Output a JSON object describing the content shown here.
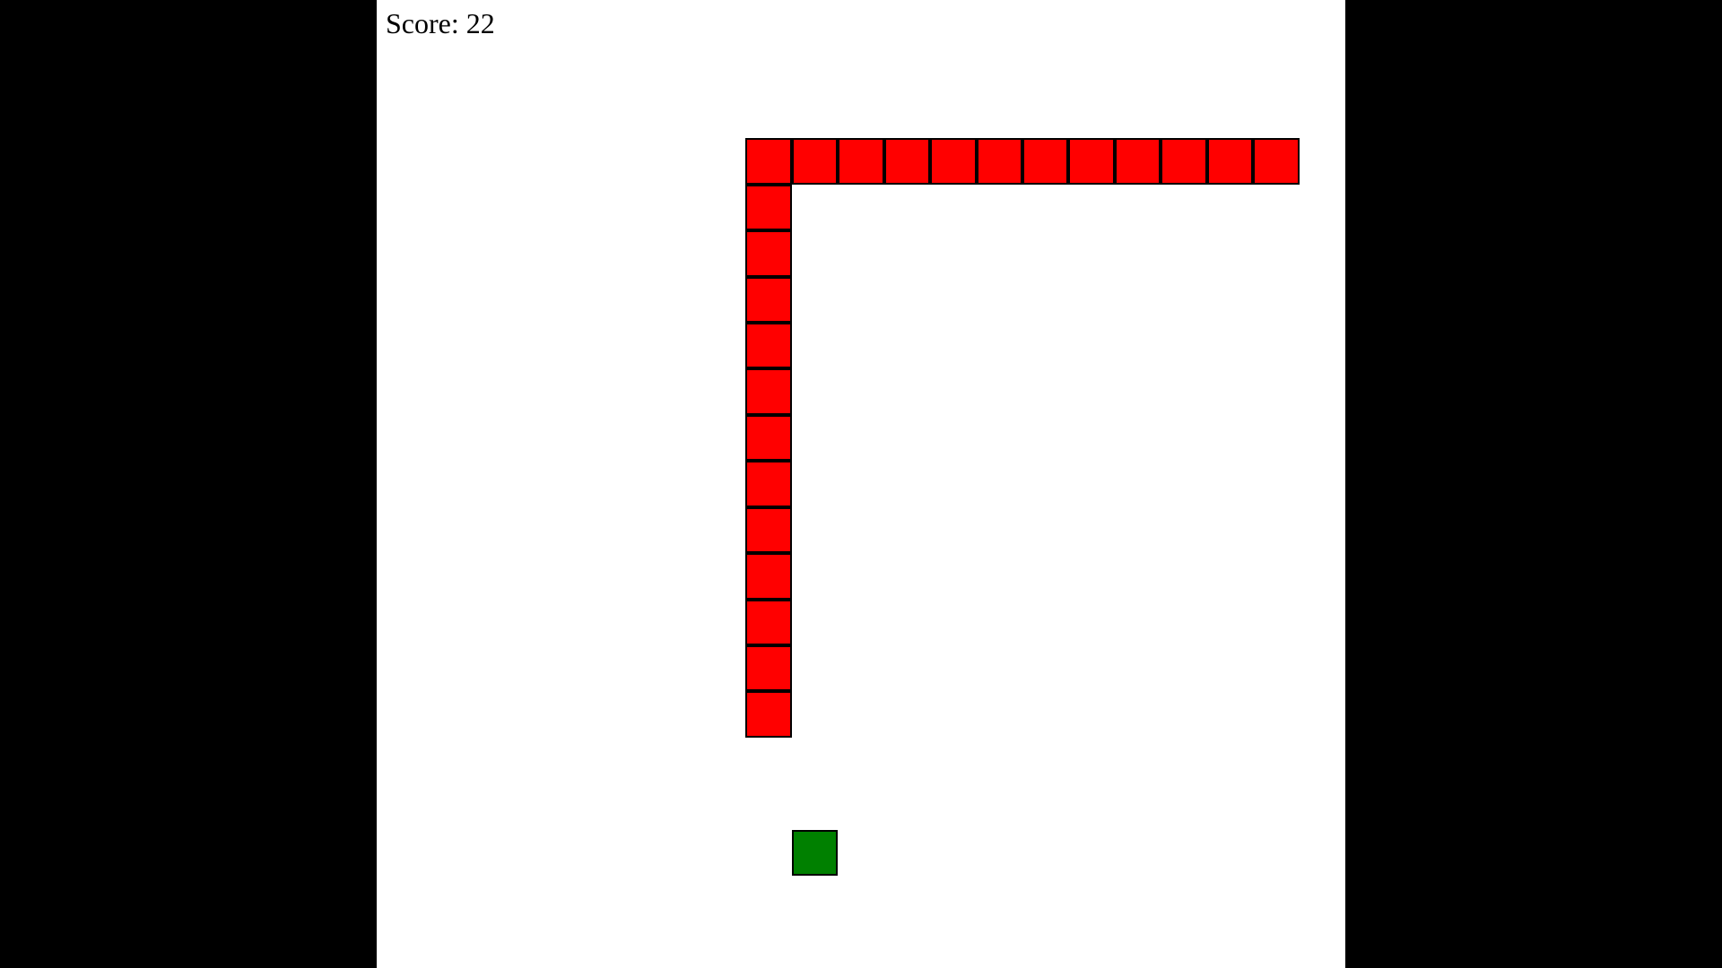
{
  "game": {
    "score_text": "Score: 22",
    "score": 22,
    "grid_size": 21,
    "snake_color": "#ff0000",
    "food_color": "#008000",
    "background_color": "#ffffff",
    "border_color": "#000000",
    "page_background_color": "#000000"
  },
  "snake": {
    "segments": [
      {
        "col": 19,
        "row": 3
      },
      {
        "col": 18,
        "row": 3
      },
      {
        "col": 17,
        "row": 3
      },
      {
        "col": 16,
        "row": 3
      },
      {
        "col": 15,
        "row": 3
      },
      {
        "col": 14,
        "row": 3
      },
      {
        "col": 13,
        "row": 3
      },
      {
        "col": 12,
        "row": 3
      },
      {
        "col": 11,
        "row": 3
      },
      {
        "col": 10,
        "row": 3
      },
      {
        "col": 9,
        "row": 3
      },
      {
        "col": 8,
        "row": 3
      },
      {
        "col": 8,
        "row": 4
      },
      {
        "col": 8,
        "row": 5
      },
      {
        "col": 8,
        "row": 6
      },
      {
        "col": 8,
        "row": 7
      },
      {
        "col": 8,
        "row": 8
      },
      {
        "col": 8,
        "row": 9
      },
      {
        "col": 8,
        "row": 10
      },
      {
        "col": 8,
        "row": 11
      },
      {
        "col": 8,
        "row": 12
      },
      {
        "col": 8,
        "row": 13
      },
      {
        "col": 8,
        "row": 14
      },
      {
        "col": 8,
        "row": 15
      }
    ]
  },
  "food": {
    "col": 9,
    "row": 18
  }
}
